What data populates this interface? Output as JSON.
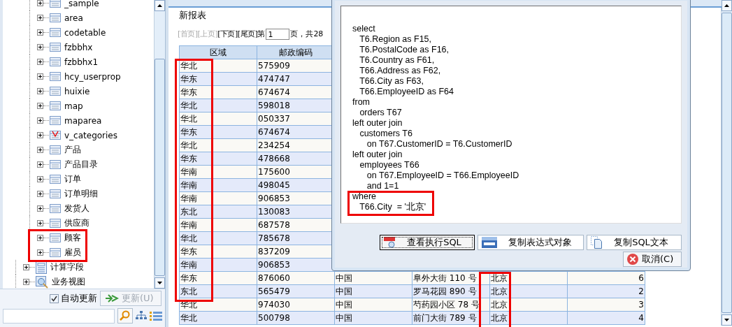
{
  "tree": [
    {
      "children": [
        {
          "label": "_sample",
          "kind": "table"
        },
        {
          "label": "area",
          "kind": "table"
        },
        {
          "label": "codetable",
          "kind": "table"
        },
        {
          "label": "fzbbhx",
          "kind": "table"
        },
        {
          "label": "fzbbhx1",
          "kind": "table"
        },
        {
          "label": "hcy_userprop",
          "kind": "table"
        },
        {
          "label": "huixie",
          "kind": "table"
        },
        {
          "label": "map",
          "kind": "table"
        },
        {
          "label": "maparea",
          "kind": "table"
        },
        {
          "label": "v_categories",
          "kind": "view"
        },
        {
          "label": "产品",
          "kind": "table"
        },
        {
          "label": "产品目录",
          "kind": "table"
        },
        {
          "label": "订单",
          "kind": "table"
        },
        {
          "label": "订单明细",
          "kind": "table"
        },
        {
          "label": "发货人",
          "kind": "table"
        },
        {
          "label": "供应商",
          "kind": "table"
        },
        {
          "label": "顾客",
          "kind": "table"
        },
        {
          "label": "雇员",
          "kind": "table"
        }
      ]
    },
    {
      "label": "计算字段",
      "kind": "calc"
    },
    {
      "label": "业务视图",
      "kind": "business"
    }
  ],
  "auto_update": {
    "label": "自动更新",
    "checked": true
  },
  "update_button": {
    "label": "更新(U)",
    "disabled": true
  },
  "report": {
    "title": "新报表",
    "pager": [
      {
        "label": "[首页]",
        "disabled": true
      },
      {
        "label": "[上页]",
        "disabled": true
      },
      {
        "label": "[下页]",
        "disabled": false
      },
      {
        "label": "[尾页]",
        "disabled": false
      }
    ],
    "page_prefix": "第",
    "page_value": "1",
    "page_suffix": "页，共28",
    "columns": [
      "区域",
      "邮政编码"
    ],
    "rows": [
      [
        "华北",
        "575909"
      ],
      [
        "华东",
        "474747"
      ],
      [
        "华东",
        "674674"
      ],
      [
        "华北",
        "598018"
      ],
      [
        "华北",
        "050337"
      ],
      [
        "华东",
        "674674"
      ],
      [
        "华北",
        "234254"
      ],
      [
        "华东",
        "478668"
      ],
      [
        "华南",
        "175600"
      ],
      [
        "华南",
        "498045"
      ],
      [
        "华南",
        "906853"
      ],
      [
        "东北",
        "130083"
      ],
      [
        "华南",
        "687578"
      ],
      [
        "华北",
        "785678"
      ],
      [
        "华东",
        "837209"
      ],
      [
        "华南",
        "906853"
      ],
      [
        "华东",
        "876060",
        "中国",
        "阜外大街 110 号",
        "北京",
        "6"
      ],
      [
        "东北",
        "565479",
        "中国",
        "罗马花园 890 号",
        "北京",
        "2"
      ],
      [
        "华北",
        "974030",
        "中国",
        "芍药园小区 78 号",
        "北京",
        "3"
      ],
      [
        "华北",
        "500798",
        "中国",
        "前门大街 789 号",
        "北京",
        "4"
      ]
    ]
  },
  "dialog": {
    "sql_lines": [
      "select",
      "   T6.Region as F15,",
      "   T6.PostalCode as F16,",
      "   T6.Country as F61,",
      "   T66.Address as F62,",
      "   T66.City as F63,",
      "   T66.EmployeeID as F64",
      "from",
      "   orders T67",
      "left outer join",
      "   customers T6",
      "      on T67.CustomerID = T6.CustomerID",
      "left outer join",
      "   employees T66",
      "      on T67.EmployeeID = T66.EmployeeID",
      "      and 1=1",
      "where",
      "   T66.City  = '北京'"
    ],
    "buttons": [
      {
        "label": "查看执行SQL",
        "kind": "sql",
        "focused": true
      },
      {
        "label": "复制表达式对象",
        "kind": "html",
        "focused": false
      },
      {
        "label": "复制SQL文本",
        "kind": "copy",
        "focused": false
      }
    ],
    "cancel": "取消(C)"
  }
}
